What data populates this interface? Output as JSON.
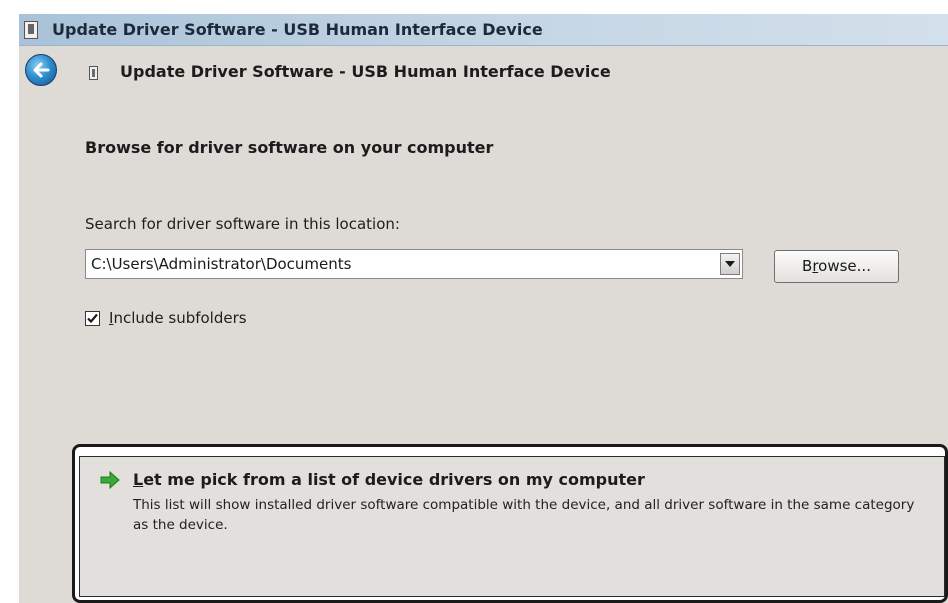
{
  "window": {
    "title": "Update Driver Software - USB Human Interface Device"
  },
  "nav": {
    "title": "Update Driver Software - USB Human Interface Device",
    "back_icon": "back-arrow-icon"
  },
  "content": {
    "heading": "Browse for driver software on your computer",
    "search_label": "Search for driver software in this location:",
    "path_value": "C:\\Users\\Administrator\\Documents",
    "browse": {
      "pre": "B",
      "accel": "r",
      "post": "owse..."
    },
    "include_subfolders": {
      "checked": true,
      "accel": "I",
      "rest": "nclude subfolders"
    }
  },
  "pick_option": {
    "icon": "green-arrow-icon",
    "title_accel": "L",
    "title_rest": "et me pick from a list of device drivers on my computer",
    "description": "This list will show installed driver software compatible with the device, and all driver software in the same category as the device."
  },
  "colors": {
    "window_bg": "#dedbd6",
    "accent_green": "#3aa83a",
    "back_button_blue": "#2f8fd0"
  }
}
